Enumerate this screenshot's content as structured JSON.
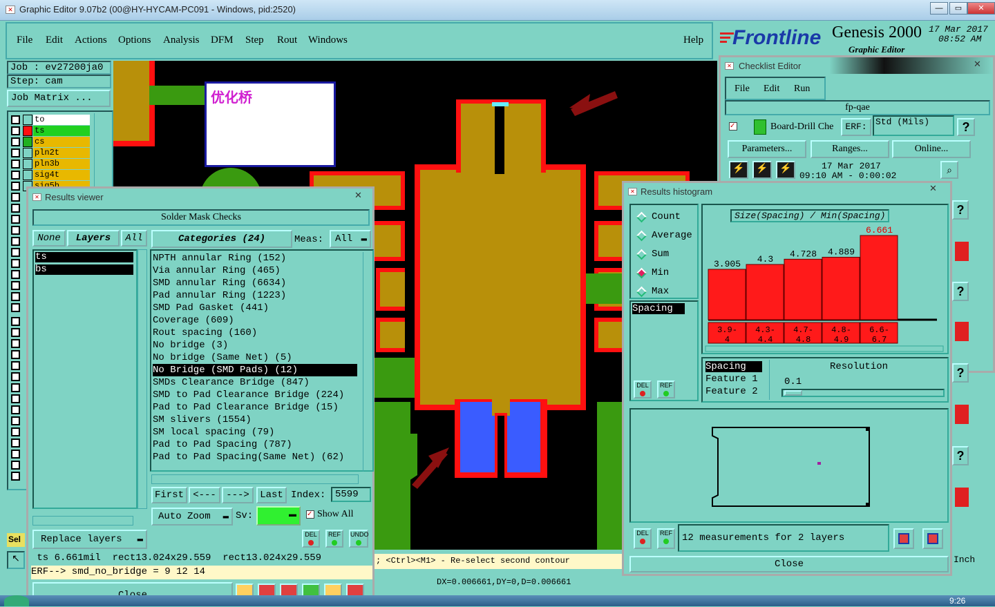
{
  "window": {
    "title": "Graphic Editor 9.07b2 (00@HY-HYCAM-PC091 - Windows, pid:2520)"
  },
  "menubar": {
    "items": [
      "File",
      "Edit",
      "Actions",
      "Options",
      "Analysis",
      "DFM",
      "Step",
      "Rout",
      "Windows"
    ],
    "help": "Help"
  },
  "brand": {
    "logo": "Frontline",
    "product": "Genesis 2000",
    "subtitle": "Graphic Editor",
    "date": "17 Mar 2017",
    "time": "08:52 AM"
  },
  "job": {
    "job_line": "Job : ev27200ja0",
    "step_line": "Step: cam",
    "matrix_button": "Job Matrix ..."
  },
  "layers": [
    {
      "name": "to",
      "color": "#ffffff"
    },
    {
      "name": "ts",
      "color": "#20d020"
    },
    {
      "name": "cs",
      "color": "#d8a000"
    },
    {
      "name": "pln2t",
      "color": "#d8a000"
    },
    {
      "name": "pln3b",
      "color": "#d8a000"
    },
    {
      "name": "sig4t",
      "color": "#d8a000"
    },
    {
      "name": "sig5b",
      "color": "#d8a000"
    }
  ],
  "canvas": {
    "annotation": "优化桥",
    "status_hint": "; <Ctrl><M1> - Re-select second contour",
    "coords": "DX=0.006661,DY=0,D=0.006661",
    "sel_label": "Sel",
    "inch_label": "Inch"
  },
  "results_viewer": {
    "title": "Results viewer",
    "header": "Solder Mask Checks",
    "layer_buttons": {
      "none": "None",
      "layers": "Layers",
      "all": "All"
    },
    "categories_label": "Categories (24)",
    "meas_label": "Meas:",
    "meas_value": "All",
    "layer_list": [
      "ts",
      "bs"
    ],
    "categories": [
      "NPTH annular Ring (152)",
      "Via annular Ring (465)",
      "SMD annular Ring (6634)",
      "Pad annular Ring (1223)",
      "SMD Pad Gasket (441)",
      "Coverage (609)",
      "Rout spacing (160)",
      "No bridge (3)",
      "No bridge (Same Net) (5)",
      "No Bridge (SMD Pads) (12)",
      "SMDs Clearance Bridge (847)",
      "SMD to Pad Clearance Bridge (224)",
      "Pad to Pad Clearance Bridge (15)",
      "SM slivers (1554)",
      "SM local spacing (79)",
      "Pad to Pad Spacing (787)",
      "Pad to Pad Spacing(Same Net) (62)"
    ],
    "selected_index": 9,
    "nav": {
      "first": "First",
      "prev": "<---",
      "next": "--->",
      "last": "Last",
      "index_label": "Index:",
      "index_value": "5599"
    },
    "zoom": "Auto Zoom",
    "sv_label": "Sv:",
    "show_all": "Show All",
    "replace_layers": "Replace layers",
    "del": "DEL",
    "ref": "REF",
    "undo": "UNDO",
    "status_line": " ts 6.661mil  rect13.024x29.559  rect13.024x29.559",
    "erf_line": "ERF--> smd_no_bridge = 9 12 14",
    "close": "Close"
  },
  "checklist_editor": {
    "title": "Checklist Editor",
    "menu": [
      "File",
      "Edit",
      "Run"
    ],
    "name": "fp-qae",
    "check_name": "Board-Drill Che",
    "erf_label": "ERF:",
    "erf_value": "Std (Mils)",
    "help": "?",
    "params": "Parameters...",
    "ranges": "Ranges...",
    "online": "Online...",
    "run_date": "17 Mar 2017",
    "run_time": "09:10 AM - 0:00:02"
  },
  "histogram": {
    "title": "Results histogram",
    "modes": [
      "Count",
      "Average",
      "Sum",
      "Min",
      "Max"
    ],
    "selected_mode": "Min",
    "chart_title": "Size(Spacing) / Min(Spacing)",
    "list_item": "Spacing",
    "resolution_label": "Resolution",
    "resolution_value": "0.1",
    "features": [
      "Spacing",
      "Feature 1",
      "Feature 2"
    ],
    "measurements": "12 measurements for 2 layers",
    "close": "Close",
    "bar_color": "#ff1a1a"
  },
  "chart_data": {
    "type": "bar",
    "title": "Size(Spacing) / Min(Spacing)",
    "categories": [
      "3.9-4",
      "4.3-4.4",
      "4.7-4.8",
      "4.8-4.9",
      "6.6-6.7"
    ],
    "values": [
      3.905,
      4.3,
      4.728,
      4.889,
      6.661
    ],
    "value_labels": [
      "3.905",
      "4.3",
      "4.728",
      "4.889",
      "6.661"
    ],
    "category_labels": [
      [
        "3.9-",
        "4"
      ],
      [
        "4.3-",
        "4.4"
      ],
      [
        "4.7-",
        "4.8"
      ],
      [
        "4.8-",
        "4.9"
      ],
      [
        "6.6-",
        "6.7"
      ]
    ],
    "ylim": [
      0,
      6.661
    ]
  },
  "taskbar": {
    "time": "9:26"
  }
}
